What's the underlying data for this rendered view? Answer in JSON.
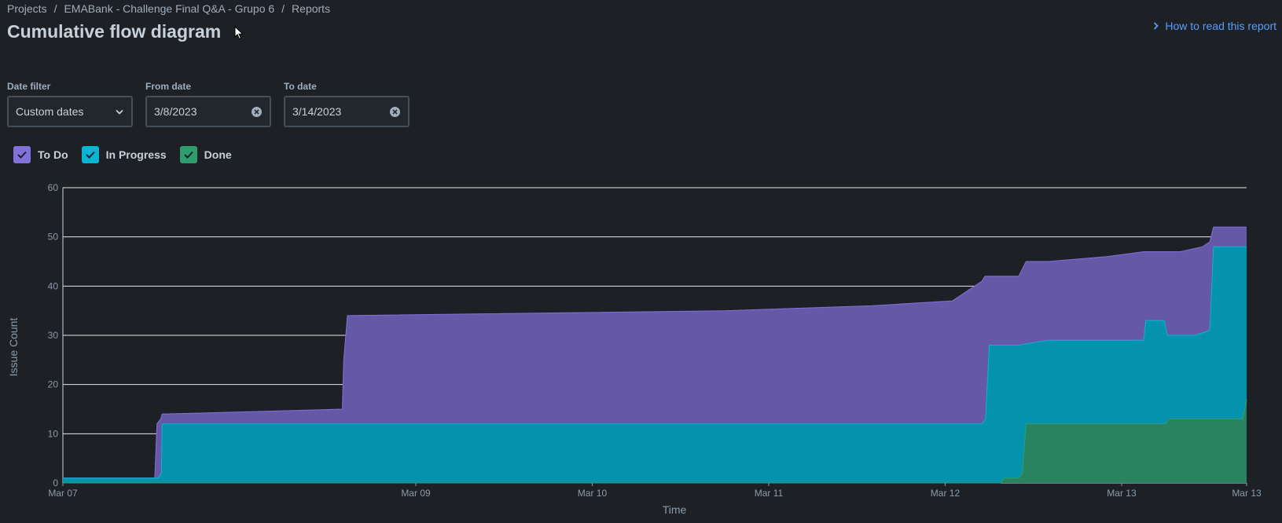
{
  "breadcrumb": {
    "items": [
      "Projects",
      "EMABank - Challenge Final Q&A - Grupo 6",
      "Reports"
    ],
    "separator": "/"
  },
  "page": {
    "title": "Cumulative flow diagram",
    "help_link": "How to read this report"
  },
  "filters": {
    "date_filter": {
      "label": "Date filter",
      "value": "Custom dates"
    },
    "from_date": {
      "label": "From date",
      "value": "3/8/2023"
    },
    "to_date": {
      "label": "To date",
      "value": "3/14/2023"
    }
  },
  "legend": [
    {
      "label": "To Do",
      "color": "#8270db",
      "checked": true
    },
    {
      "label": "In Progress",
      "color": "#0ab4d2",
      "checked": true
    },
    {
      "label": "Done",
      "color": "#2e9e6e",
      "checked": true
    }
  ],
  "chart_data": {
    "type": "area",
    "stacked": true,
    "xlabel": "Time",
    "ylabel": "Issue Count",
    "ylim": [
      0,
      60
    ],
    "yticks": [
      0,
      10,
      20,
      30,
      40,
      50,
      60
    ],
    "grid": true,
    "x_range": [
      "Mar 07 00:00",
      "Mar 13 17:00"
    ],
    "xticks": [
      {
        "label": "Mar 07",
        "hours": 0
      },
      {
        "label": "Mar 09",
        "hours": 48
      },
      {
        "label": "Mar 10",
        "hours": 72
      },
      {
        "label": "Mar 11",
        "hours": 96
      },
      {
        "label": "Mar 12",
        "hours": 120
      },
      {
        "label": "Mar 13",
        "hours": 144
      },
      {
        "label": "Mar 13",
        "hours": 161
      }
    ],
    "series": [
      {
        "name": "Done",
        "color": "#2e9e6e",
        "points": [
          [
            0,
            0
          ],
          [
            127.5,
            0
          ],
          [
            128,
            1
          ],
          [
            130,
            1
          ],
          [
            130.5,
            2
          ],
          [
            131,
            12
          ],
          [
            144,
            12
          ],
          [
            145,
            12
          ],
          [
            150,
            12
          ],
          [
            150.5,
            13
          ],
          [
            160.5,
            13
          ],
          [
            161,
            17
          ]
        ]
      },
      {
        "name": "In Progress",
        "color": "#0ab4d2",
        "points": [
          [
            0,
            1
          ],
          [
            13,
            1
          ],
          [
            13.4,
            2
          ],
          [
            13.5,
            12
          ],
          [
            45,
            12
          ],
          [
            60,
            12
          ],
          [
            100,
            12
          ],
          [
            122,
            12
          ],
          [
            125,
            12
          ],
          [
            125.5,
            13
          ],
          [
            126,
            28
          ],
          [
            130,
            28
          ],
          [
            134,
            29
          ],
          [
            147,
            29
          ],
          [
            147.3,
            33
          ],
          [
            149.8,
            33
          ],
          [
            150.2,
            30
          ],
          [
            154,
            30
          ],
          [
            156,
            31
          ],
          [
            156.5,
            48
          ],
          [
            161,
            48
          ]
        ]
      },
      {
        "name": "To Do",
        "color": "#8270db",
        "points": [
          [
            0,
            1
          ],
          [
            12.5,
            1
          ],
          [
            12.8,
            12
          ],
          [
            13.3,
            13
          ],
          [
            13.5,
            14
          ],
          [
            38,
            15
          ],
          [
            38.2,
            25
          ],
          [
            38.7,
            34
          ],
          [
            90,
            35
          ],
          [
            100,
            35.5
          ],
          [
            110,
            36
          ],
          [
            121,
            37
          ],
          [
            123,
            39
          ],
          [
            125,
            41
          ],
          [
            125.4,
            42
          ],
          [
            130,
            42
          ],
          [
            131,
            45
          ],
          [
            134,
            45
          ],
          [
            142,
            46
          ],
          [
            147,
            47
          ],
          [
            152,
            47
          ],
          [
            155,
            48
          ],
          [
            156,
            49
          ],
          [
            156.5,
            52
          ],
          [
            161,
            52
          ]
        ]
      }
    ]
  }
}
